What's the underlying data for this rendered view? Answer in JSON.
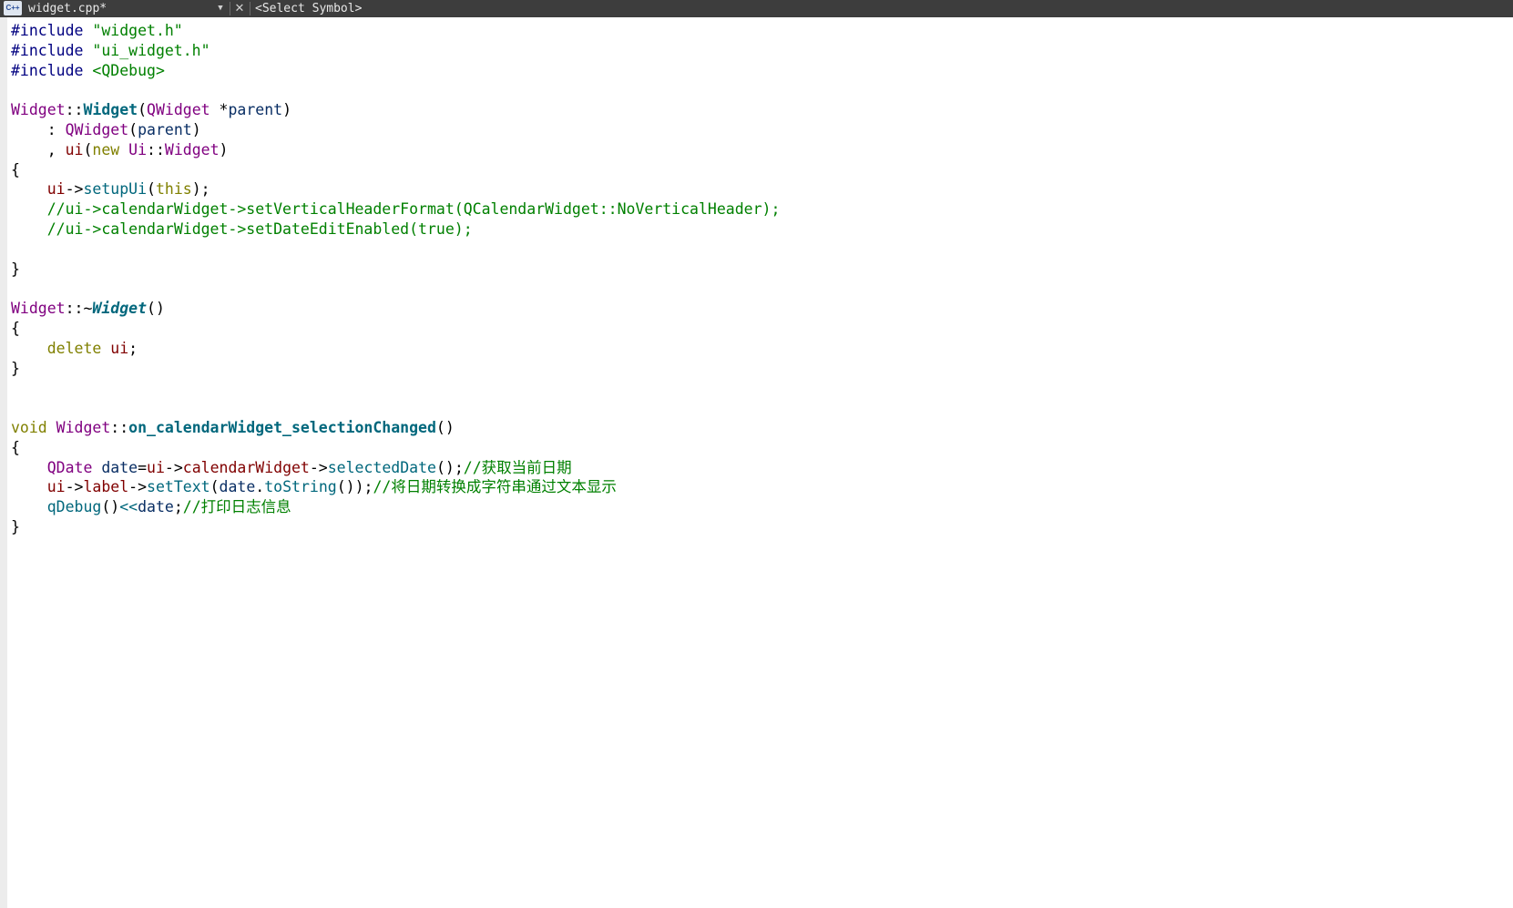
{
  "tab": {
    "icon_label": "C++",
    "file_name": "widget.cpp*",
    "symbol_placeholder": "<Select Symbol>"
  },
  "code": {
    "lines": [
      [
        {
          "c": "p",
          "t": "#include "
        },
        {
          "c": "s",
          "t": "\"widget.h\""
        }
      ],
      [
        {
          "c": "p",
          "t": "#include "
        },
        {
          "c": "s",
          "t": "\"ui_widget.h\""
        }
      ],
      [
        {
          "c": "p",
          "t": "#include "
        },
        {
          "c": "s",
          "t": "<QDebug>"
        }
      ],
      [],
      [
        {
          "c": "t",
          "t": "Widget"
        },
        {
          "c": "",
          "t": "::"
        },
        {
          "c": "fb",
          "t": "Widget"
        },
        {
          "c": "",
          "t": "("
        },
        {
          "c": "t",
          "t": "QWidget"
        },
        {
          "c": "",
          "t": " *"
        },
        {
          "c": "v",
          "t": "parent"
        },
        {
          "c": "",
          "t": ")"
        }
      ],
      [
        {
          "c": "",
          "t": "    : "
        },
        {
          "c": "t",
          "t": "QWidget"
        },
        {
          "c": "",
          "t": "("
        },
        {
          "c": "v",
          "t": "parent"
        },
        {
          "c": "",
          "t": ")"
        }
      ],
      [
        {
          "c": "",
          "t": "    , "
        },
        {
          "c": "m",
          "t": "ui"
        },
        {
          "c": "",
          "t": "("
        },
        {
          "c": "k",
          "t": "new "
        },
        {
          "c": "t",
          "t": "Ui"
        },
        {
          "c": "",
          "t": "::"
        },
        {
          "c": "t",
          "t": "Widget"
        },
        {
          "c": "",
          "t": ")"
        }
      ],
      [
        {
          "c": "",
          "t": "{"
        }
      ],
      [
        {
          "c": "",
          "t": "    "
        },
        {
          "c": "m",
          "t": "ui"
        },
        {
          "c": "",
          "t": "->"
        },
        {
          "c": "f",
          "t": "setupUi"
        },
        {
          "c": "",
          "t": "("
        },
        {
          "c": "k",
          "t": "this"
        },
        {
          "c": "",
          "t": ");"
        }
      ],
      [
        {
          "c": "",
          "t": "    "
        },
        {
          "c": "c",
          "t": "//ui->calendarWidget->setVerticalHeaderFormat(QCalendarWidget::NoVerticalHeader);"
        }
      ],
      [
        {
          "c": "",
          "t": "    "
        },
        {
          "c": "c",
          "t": "//ui->calendarWidget->setDateEditEnabled(true);"
        }
      ],
      [],
      [
        {
          "c": "",
          "t": "}"
        }
      ],
      [],
      [
        {
          "c": "t",
          "t": "Widget"
        },
        {
          "c": "",
          "t": "::~"
        },
        {
          "c": "fbi",
          "t": "Widget"
        },
        {
          "c": "",
          "t": "()"
        }
      ],
      [
        {
          "c": "",
          "t": "{"
        }
      ],
      [
        {
          "c": "",
          "t": "    "
        },
        {
          "c": "k",
          "t": "delete "
        },
        {
          "c": "m",
          "t": "ui"
        },
        {
          "c": "",
          "t": ";"
        }
      ],
      [
        {
          "c": "",
          "t": "}"
        }
      ],
      [],
      [],
      [
        {
          "c": "k",
          "t": "void "
        },
        {
          "c": "t",
          "t": "Widget"
        },
        {
          "c": "",
          "t": "::"
        },
        {
          "c": "fb",
          "t": "on_calendarWidget_selectionChanged"
        },
        {
          "c": "",
          "t": "()"
        }
      ],
      [
        {
          "c": "",
          "t": "{"
        }
      ],
      [
        {
          "c": "",
          "t": "    "
        },
        {
          "c": "t",
          "t": "QDate"
        },
        {
          "c": "",
          "t": " "
        },
        {
          "c": "v",
          "t": "date"
        },
        {
          "c": "",
          "t": "="
        },
        {
          "c": "m",
          "t": "ui"
        },
        {
          "c": "",
          "t": "->"
        },
        {
          "c": "m",
          "t": "calendarWidget"
        },
        {
          "c": "",
          "t": "->"
        },
        {
          "c": "f",
          "t": "selectedDate"
        },
        {
          "c": "",
          "t": "();"
        },
        {
          "c": "c",
          "t": "//获取当前日期"
        }
      ],
      [
        {
          "c": "",
          "t": "    "
        },
        {
          "c": "m",
          "t": "ui"
        },
        {
          "c": "",
          "t": "->"
        },
        {
          "c": "m",
          "t": "label"
        },
        {
          "c": "",
          "t": "->"
        },
        {
          "c": "f",
          "t": "setText"
        },
        {
          "c": "",
          "t": "("
        },
        {
          "c": "v",
          "t": "date"
        },
        {
          "c": "",
          "t": "."
        },
        {
          "c": "f",
          "t": "toString"
        },
        {
          "c": "",
          "t": "());"
        },
        {
          "c": "c",
          "t": "//将日期转换成字符串通过文本显示"
        }
      ],
      [
        {
          "c": "",
          "t": "    "
        },
        {
          "c": "f",
          "t": "qDebug"
        },
        {
          "c": "",
          "t": "()"
        },
        {
          "c": "f",
          "t": "<<"
        },
        {
          "c": "v",
          "t": "date"
        },
        {
          "c": "",
          "t": ";"
        },
        {
          "c": "c",
          "t": "//打印日志信息"
        }
      ],
      [
        {
          "c": "",
          "t": "}"
        }
      ]
    ]
  }
}
